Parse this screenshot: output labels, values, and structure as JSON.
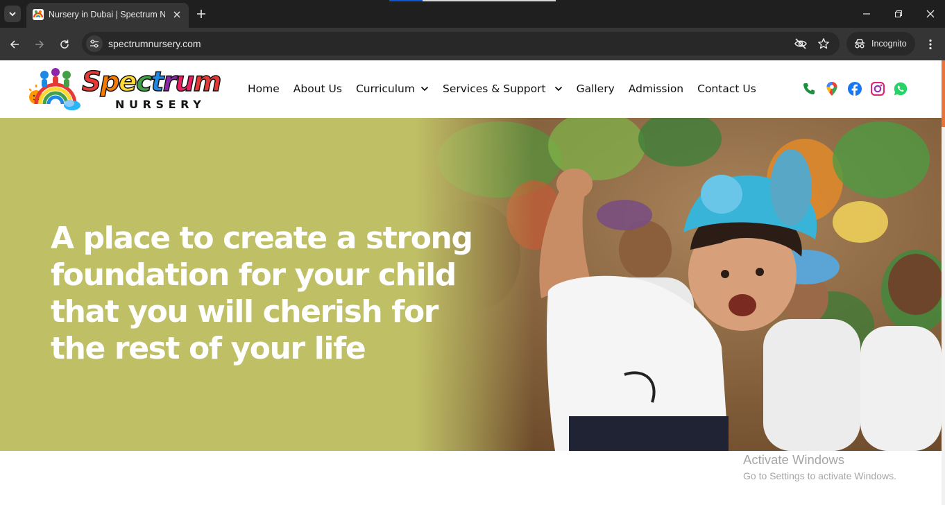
{
  "browser": {
    "tab": {
      "title": "Nursery in Dubai | Spectrum Nursery",
      "favicon": "spectrum-logo-icon"
    },
    "url": "spectrumnursery.com",
    "page_load_progress": 0.2,
    "profile_label": "Incognito",
    "icons": {
      "tab_search": "chevron-down-icon",
      "new_tab": "plus-icon",
      "back": "arrow-left-icon",
      "forward": "arrow-right-icon",
      "reload": "reload-icon",
      "site_info": "tune-icon",
      "tracking_protection": "eye-off-icon",
      "bookmark": "star-icon",
      "menu": "kebab-menu-icon",
      "minimize": "minimize-icon",
      "restore": "restore-icon",
      "close": "close-icon"
    }
  },
  "site": {
    "logo": {
      "word": "Spectrum",
      "sub": "NURSERY",
      "letter_colors": [
        "#e53935",
        "#f57c00",
        "#fdd835",
        "#43a047",
        "#1e88e5",
        "#8e24aa",
        "#e91e63",
        "#e53935"
      ]
    },
    "nav": [
      {
        "label": "Home",
        "has_dropdown": false
      },
      {
        "label": "About Us",
        "has_dropdown": false
      },
      {
        "label": "Curriculum",
        "has_dropdown": true
      },
      {
        "label": "Services & Support",
        "has_dropdown": true
      },
      {
        "label": "Gallery",
        "has_dropdown": false
      },
      {
        "label": "Admission",
        "has_dropdown": false
      },
      {
        "label": "Contact Us",
        "has_dropdown": false
      }
    ],
    "social": [
      {
        "name": "phone-icon",
        "color": "#1a8f3c"
      },
      {
        "name": "map-pin-icon",
        "color": "#ea4335"
      },
      {
        "name": "facebook-icon",
        "color": "#1877f2"
      },
      {
        "name": "instagram-icon",
        "color": "#d62976"
      },
      {
        "name": "whatsapp-icon",
        "color": "#25d366"
      }
    ],
    "hero": {
      "heading": "A place to create a strong foundation for your child that you will cherish for the rest of your life",
      "background_color": "#bfbf66",
      "photo": "children-dancing-photo"
    },
    "accent_color": "#e8743b"
  },
  "os_watermark": {
    "title": "Activate Windows",
    "subtitle": "Go to Settings to activate Windows."
  }
}
